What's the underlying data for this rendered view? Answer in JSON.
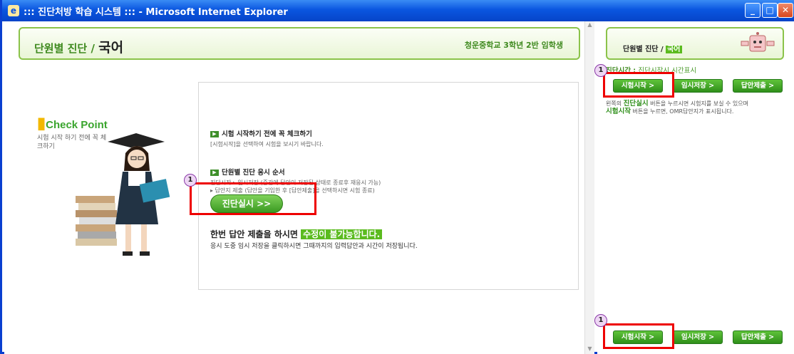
{
  "window": {
    "title": "::: 진단처방 학습 시스템 ::: - Microsoft Internet Explorer",
    "minimize_label": "_",
    "maximize_label": "□",
    "close_label": "✕"
  },
  "header": {
    "section_label": "단원별 진단 / ",
    "subject": "국어",
    "student_info": "청운중학교 3학년 2반 임학생"
  },
  "checkpoint": {
    "title_prefix": "",
    "title": "Check Point",
    "subtitle": "시험 시작 하기 전에 꼭 체크하기"
  },
  "instructions": {
    "section1_title": "시험 시작하기 전에 꼭 체크하기",
    "section1_body": "[시험시작]을 선택하여 시험을 보시기 바랍니다.",
    "section2_title": "단원별 진단 응시 순서",
    "section2_line1": "진단시작 ▸ 임시저장 (중간에 답안이 저장된 상태로 종료후 재응시 가능)",
    "section2_line2": "▸ 답안지 제출 (답안을 기입한 후 [답안제출]을 선택하시면 시험 종료)",
    "start_button": "진단실시 >>",
    "warning_prefix": "한번 답안 제출을 하시면 ",
    "warning_highlight": "수정이 불가능합니다.",
    "warning_detail": "응시 도중 임시 저장을 클릭하시면 그때까지의 입력답안과 시간이 저장됩니다."
  },
  "markers": {
    "step": "1"
  },
  "right_panel": {
    "title": "단원별 진단 / ",
    "subject_highlight": "국어",
    "time_label": "진단시간 : ",
    "time_value": "진단시작시 시간표시",
    "top_buttons": {
      "start": "시험시작 >",
      "save": "임시저장 >",
      "submit": "답안제출 >"
    },
    "desc_prefix": "왼쪽의 ",
    "desc_bold1": "진단실시",
    "desc_mid": " 버튼을 누르시면 시험지를 보실 수 있으며 ",
    "desc_bold2": "시험시작",
    "desc_suffix": " 버튼을 누르면, OMR답안지가 표시됩니다.",
    "bottom_buttons": {
      "start": "시험시작 >",
      "save": "임시저장 >",
      "submit": "답안제출 >"
    }
  },
  "colors": {
    "titlebar": "#0a56e0",
    "accent_green": "#3b9a22",
    "highlight_red": "#e00000",
    "marker_fill": "#eed6f4"
  }
}
